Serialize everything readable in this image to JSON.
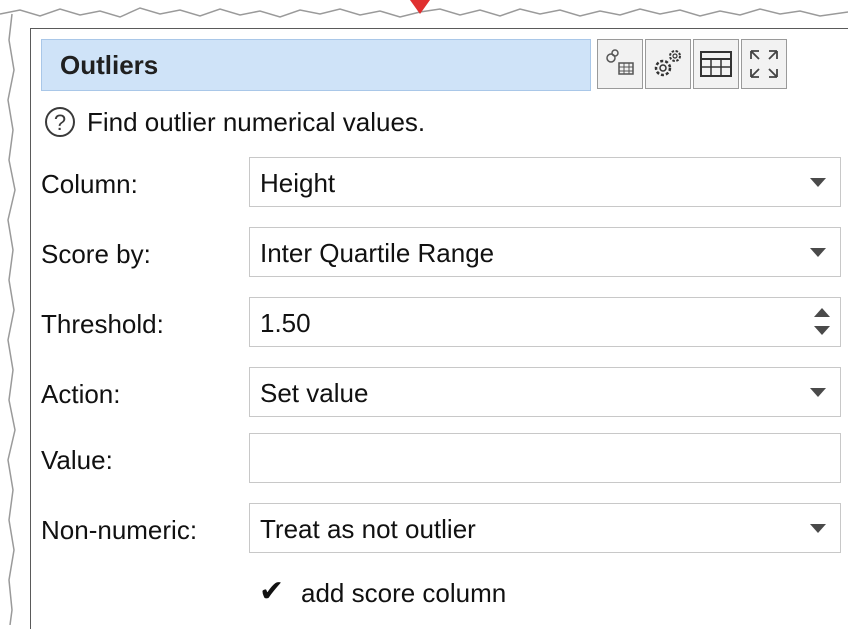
{
  "panel": {
    "title": "Outliers",
    "toolbar": {
      "icons": [
        "link-table-icon",
        "settings-gears-icon",
        "table-icon",
        "expand-icon"
      ]
    },
    "help_text": "Find outlier numerical values.",
    "fields": {
      "column": {
        "label": "Column:",
        "value": "Height"
      },
      "score_by": {
        "label": "Score by:",
        "value": "Inter Quartile Range"
      },
      "threshold": {
        "label": "Threshold:",
        "value": "1.50"
      },
      "action": {
        "label": "Action:",
        "value": "Set value"
      },
      "value": {
        "label": "Value:",
        "value": ""
      },
      "non_numeric": {
        "label": "Non-numeric:",
        "value": "Treat as not outlier"
      }
    },
    "add_score_column": {
      "label": "add score column",
      "checked": true,
      "mark": "✔"
    }
  },
  "colors": {
    "title_bg": "#cfe3f8",
    "accent_arrow": "#e03030"
  }
}
